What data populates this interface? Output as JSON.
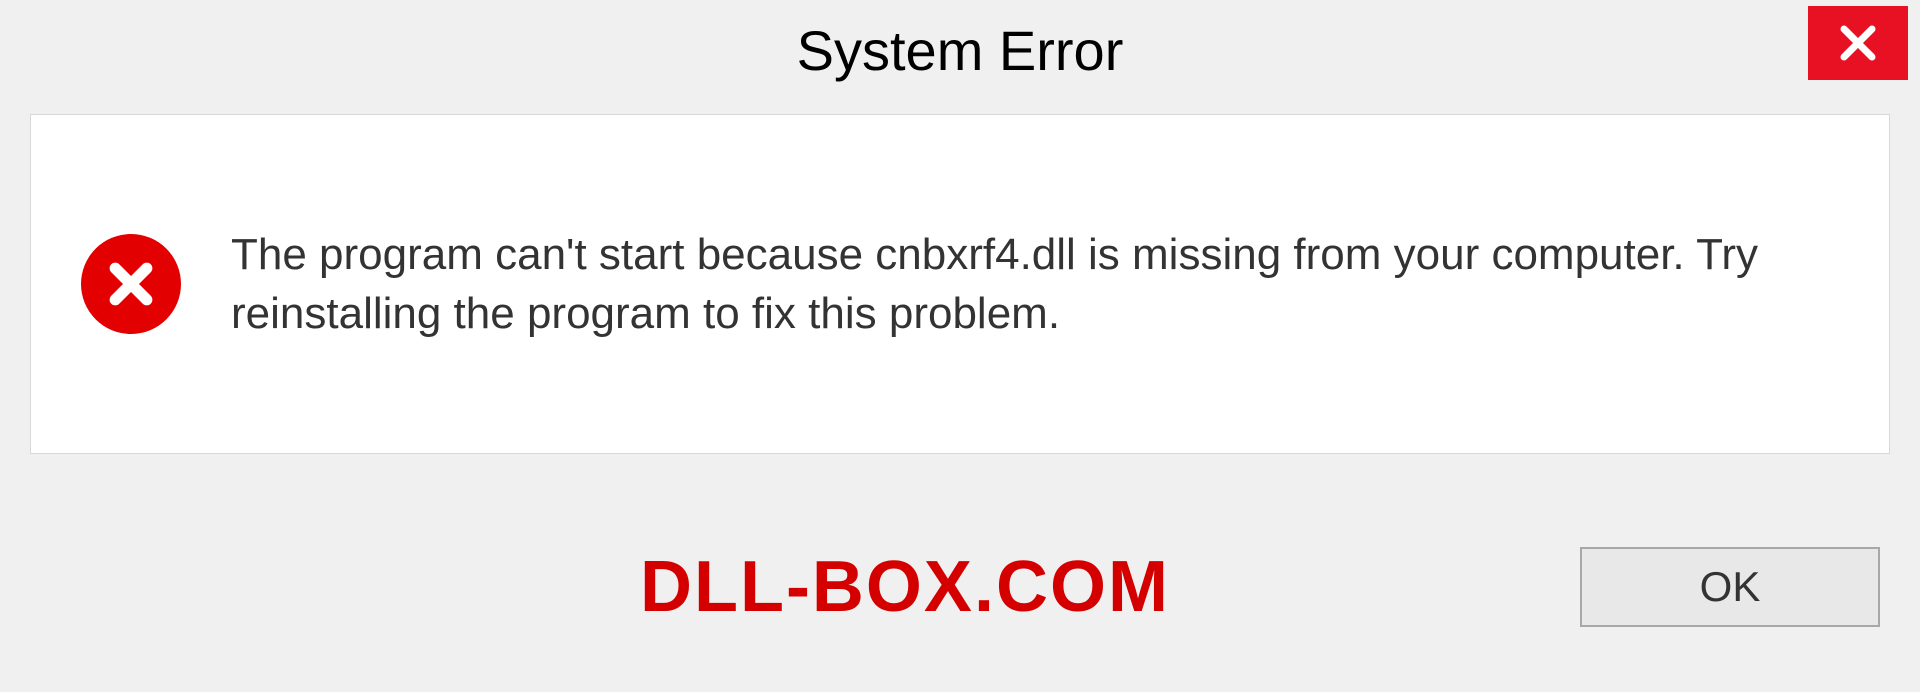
{
  "title": "System Error",
  "message": "The program can't start because cnbxrf4.dll is missing from your computer. Try reinstalling the program to fix this problem.",
  "ok_label": "OK",
  "watermark": "DLL-BOX.COM"
}
